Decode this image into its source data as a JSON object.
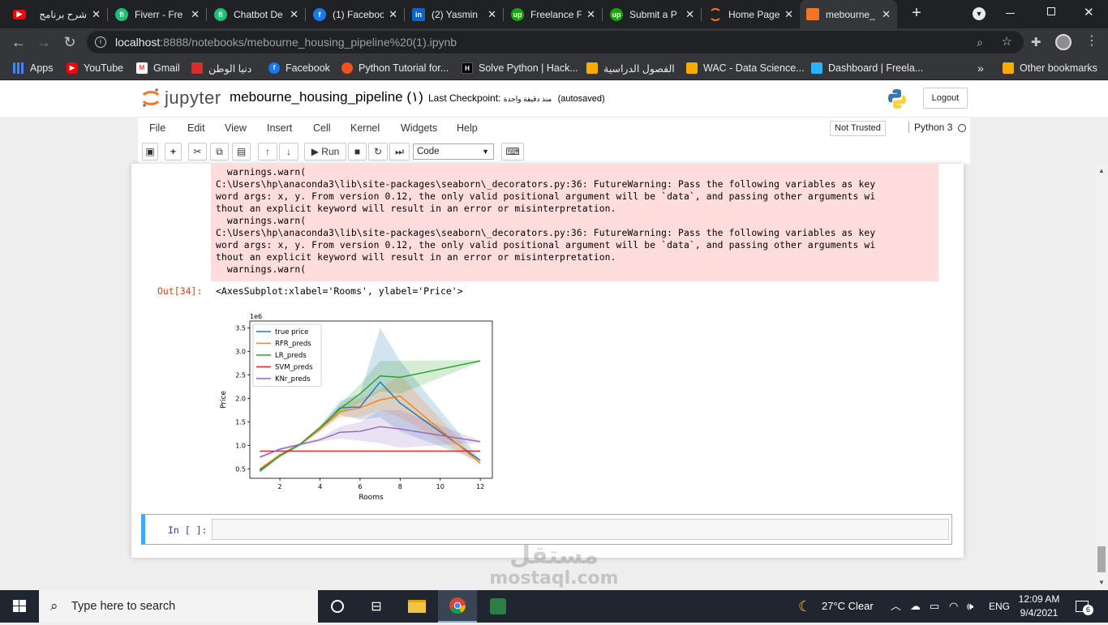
{
  "browser": {
    "tabs": [
      {
        "title": "شرح برنامج",
        "favicon": "youtube-icon",
        "color": "#ff0000"
      },
      {
        "title": "Fiverr - Fre",
        "favicon": "fiverr-icon",
        "color": "#1dbf73"
      },
      {
        "title": "Chatbot De",
        "favicon": "fiverr-icon",
        "color": "#1dbf73"
      },
      {
        "title": "(1) Faceboo",
        "favicon": "facebook-icon",
        "color": "#1877f2"
      },
      {
        "title": "(2) Yasmin",
        "favicon": "linkedin-icon",
        "color": "#0a66c2"
      },
      {
        "title": "Freelance F",
        "favicon": "upwork-icon",
        "color": "#14a800"
      },
      {
        "title": "Submit a P",
        "favicon": "upwork-icon",
        "color": "#14a800"
      },
      {
        "title": "Home Page",
        "favicon": "jupyter-icon",
        "color": "#f37626"
      },
      {
        "title": "mebourne_",
        "favicon": "notebook-icon",
        "color": "#f37626",
        "active": true
      }
    ],
    "url_host": "localhost",
    "url_rest": ":8888/notebooks/mebourne_housing_pipeline%20(1).ipynb",
    "bookmarks": [
      {
        "label": "Apps",
        "icon": "apps-grid-icon",
        "color": "#4285f4"
      },
      {
        "label": "YouTube",
        "icon": "youtube-icon",
        "color": "#ff0000"
      },
      {
        "label": "Gmail",
        "icon": "gmail-icon",
        "color": "#ea4335"
      },
      {
        "label": "دنيا الوطن",
        "icon": "dunya-icon",
        "color": "#d32f2f"
      },
      {
        "label": "Facebook",
        "icon": "facebook-icon",
        "color": "#1877f2"
      },
      {
        "label": "Python Tutorial for...",
        "icon": "python-tutorial-icon",
        "color": "#f4511e"
      },
      {
        "label": "Solve Python | Hack...",
        "icon": "hackerrank-icon",
        "color": "#000000"
      },
      {
        "label": "الفصول الدراسية",
        "icon": "classroom-icon",
        "color": "#f9ab00"
      },
      {
        "label": "WAC - Data Science...",
        "icon": "classroom-icon",
        "color": "#f9ab00"
      },
      {
        "label": "Dashboard | Freela...",
        "icon": "freelancer-icon",
        "color": "#29b2fe"
      }
    ],
    "bookmarks_more": "»",
    "other_bookmarks": "Other bookmarks"
  },
  "jupyter": {
    "logo_text": "jupyter",
    "notebook_title": "mebourne_housing_pipeline (١)",
    "checkpoint_label": "Last Checkpoint:",
    "checkpoint_time": "منذ دقيقة واحدة",
    "autosave": "(autosaved)",
    "logout": "Logout",
    "menu": [
      "File",
      "Edit",
      "View",
      "Insert",
      "Cell",
      "Kernel",
      "Widgets",
      "Help"
    ],
    "trust_status": "Not Trusted",
    "kernel": "Python 3",
    "toolbar": {
      "run_label": "Run",
      "cell_type": "Code"
    }
  },
  "notebook": {
    "stderr_text": "  warnings.warn(\nC:\\Users\\hp\\anaconda3\\lib\\site-packages\\seaborn\\_decorators.py:36: FutureWarning: Pass the following variables as key\nword args: x, y. From version 0.12, the only valid positional argument will be `data`, and passing other arguments wi\nthout an explicit keyword will result in an error or misinterpretation.\n  warnings.warn(\nC:\\Users\\hp\\anaconda3\\lib\\site-packages\\seaborn\\_decorators.py:36: FutureWarning: Pass the following variables as key\nword args: x, y. From version 0.12, the only valid positional argument will be `data`, and passing other arguments wi\nthout an explicit keyword will result in an error or misinterpretation.\n  warnings.warn(",
    "out_prompt": "Out[34]:",
    "out_text": "<AxesSubplot:xlabel='Rooms', ylabel='Price'>",
    "in_prompt": "In [ ]:"
  },
  "chart_data": {
    "type": "line",
    "xlabel": "Rooms",
    "ylabel": "Price",
    "offset_text": "1e6",
    "xlim": [
      0.5,
      12.6
    ],
    "ylim": [
      0.3,
      3.65
    ],
    "xticks": [
      2,
      4,
      6,
      8,
      10,
      12
    ],
    "yticks": [
      0.5,
      1.0,
      1.5,
      2.0,
      2.5,
      3.0,
      3.5
    ],
    "ytick_labels": [
      "0.5",
      "1.0",
      "1.5",
      "2.0",
      "2.5",
      "3.0",
      "3.5"
    ],
    "legend_position": "upper left",
    "series": [
      {
        "name": "true price",
        "color": "#1f77b4",
        "x": [
          1,
          2,
          3,
          4,
          5,
          6,
          7,
          8,
          12
        ],
        "y": [
          0.47,
          0.78,
          1.02,
          1.35,
          1.8,
          1.82,
          2.35,
          1.9,
          0.68
        ],
        "band_upper": [
          0.5,
          0.82,
          1.05,
          1.4,
          1.95,
          2.1,
          3.5,
          2.8,
          0.7
        ],
        "band_lower": [
          0.44,
          0.74,
          0.99,
          1.3,
          1.65,
          1.55,
          1.6,
          1.3,
          0.66
        ]
      },
      {
        "name": "RFR_preds",
        "color": "#ff7f0e",
        "x": [
          1,
          2,
          3,
          4,
          5,
          6,
          7,
          8,
          12
        ],
        "y": [
          0.5,
          0.8,
          1.02,
          1.35,
          1.72,
          1.8,
          1.97,
          2.05,
          0.62
        ],
        "band_upper": [
          0.52,
          0.83,
          1.05,
          1.4,
          1.85,
          2.0,
          2.2,
          2.5,
          0.64
        ],
        "band_lower": [
          0.48,
          0.77,
          0.99,
          1.3,
          1.6,
          1.6,
          1.75,
          1.6,
          0.6
        ]
      },
      {
        "name": "LR_preds",
        "color": "#2ca02c",
        "x": [
          1,
          2,
          3,
          4,
          5,
          6,
          7,
          8,
          12
        ],
        "y": [
          0.45,
          0.78,
          1.02,
          1.38,
          1.78,
          2.1,
          2.48,
          2.45,
          2.8
        ],
        "band_upper": [
          0.48,
          0.8,
          1.05,
          1.42,
          1.88,
          2.3,
          2.8,
          2.8,
          2.82
        ],
        "band_lower": [
          0.42,
          0.76,
          0.99,
          1.34,
          1.68,
          1.9,
          2.15,
          2.1,
          2.78
        ]
      },
      {
        "name": "SVM_preds",
        "color": "#d62728",
        "x": [
          1,
          2,
          3,
          4,
          5,
          6,
          7,
          8,
          12
        ],
        "y": [
          0.88,
          0.88,
          0.88,
          0.88,
          0.88,
          0.88,
          0.88,
          0.88,
          0.88
        ],
        "band_upper": [
          0.88,
          0.88,
          0.88,
          0.88,
          0.88,
          0.88,
          0.88,
          0.88,
          0.88
        ],
        "band_lower": [
          0.88,
          0.88,
          0.88,
          0.88,
          0.88,
          0.88,
          0.88,
          0.88,
          0.88
        ]
      },
      {
        "name": "KNr_preds",
        "color": "#9467bd",
        "x": [
          1,
          2,
          3,
          4,
          5,
          6,
          7,
          8,
          12
        ],
        "y": [
          0.75,
          0.92,
          1.02,
          1.12,
          1.28,
          1.3,
          1.4,
          1.35,
          1.08
        ],
        "band_upper": [
          0.78,
          0.95,
          1.05,
          1.16,
          1.4,
          1.5,
          1.75,
          1.75,
          1.1
        ],
        "band_lower": [
          0.72,
          0.89,
          0.99,
          1.08,
          1.15,
          1.1,
          1.05,
          0.95,
          1.06
        ]
      }
    ]
  },
  "taskbar": {
    "search_placeholder": "Type here to search",
    "weather": "27°C  Clear",
    "language": "ENG",
    "time": "12:09 AM",
    "date": "9/4/2021",
    "notification_count": "6"
  },
  "watermark": {
    "arabic": "مستقل",
    "latin": "mostaql.com"
  }
}
